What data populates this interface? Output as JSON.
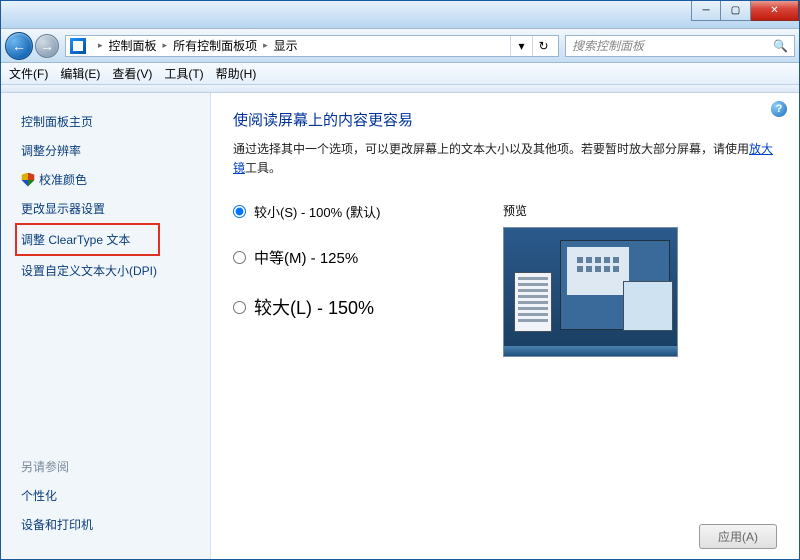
{
  "titlebar": {
    "minimize_glyph": "─",
    "maximize_glyph": "▢",
    "close_glyph": "✕"
  },
  "nav": {
    "back_glyph": "←",
    "fwd_glyph": "→",
    "crumbs": [
      "控制面板",
      "所有控制面板项",
      "显示"
    ],
    "sep": "▸",
    "dropdown_glyph": "▾",
    "refresh_glyph": "↻"
  },
  "search": {
    "placeholder": "搜索控制面板",
    "icon_glyph": "🔍"
  },
  "menu": {
    "items": [
      "文件(F)",
      "编辑(E)",
      "查看(V)",
      "工具(T)",
      "帮助(H)"
    ]
  },
  "sidebar": {
    "items": [
      {
        "label": "控制面板主页",
        "shield": false
      },
      {
        "label": "调整分辨率",
        "shield": false
      },
      {
        "label": "校准颜色",
        "shield": true
      },
      {
        "label": "更改显示器设置",
        "shield": false
      },
      {
        "label": "调整 ClearType 文本",
        "shield": false,
        "highlight": true
      },
      {
        "label": "设置自定义文本大小(DPI)",
        "shield": false
      }
    ],
    "see_also_header": "另请参阅",
    "see_also": [
      "个性化",
      "设备和打印机"
    ]
  },
  "content": {
    "help_glyph": "?",
    "heading": "使阅读屏幕上的内容更容易",
    "desc_prefix": "通过选择其中一个选项，可以更改屏幕上的文本大小以及其他项。若要暂时放大部分屏幕，请使用",
    "magnifier_link": "放大镜",
    "desc_suffix": "工具。",
    "options": [
      {
        "label": "较小(S) - 100% (默认)",
        "size": "sm",
        "checked": true
      },
      {
        "label": "中等(M) - 125%",
        "size": "md",
        "checked": false
      },
      {
        "label": "较大(L) - 150%",
        "size": "lg",
        "checked": false
      }
    ],
    "preview_label": "预览",
    "apply_label": "应用(A)"
  }
}
